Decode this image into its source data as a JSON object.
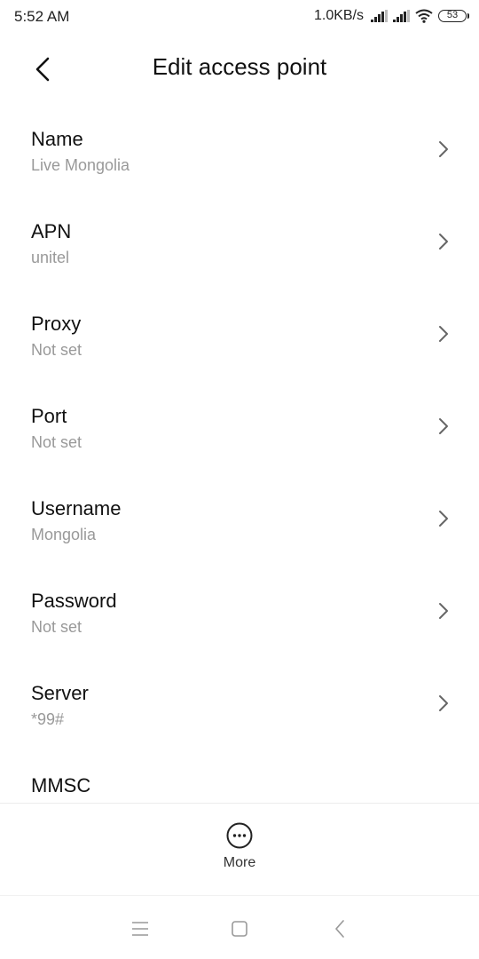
{
  "status_bar": {
    "time": "5:52 AM",
    "speed": "1.0KB/s",
    "battery": "53"
  },
  "header": {
    "title": "Edit access point"
  },
  "settings": [
    {
      "title": "Name",
      "value": "Live Mongolia"
    },
    {
      "title": "APN",
      "value": "unitel"
    },
    {
      "title": "Proxy",
      "value": "Not set"
    },
    {
      "title": "Port",
      "value": "Not set"
    },
    {
      "title": "Username",
      "value": "Mongolia"
    },
    {
      "title": "Password",
      "value": "Not set"
    },
    {
      "title": "Server",
      "value": "*99#"
    },
    {
      "title": "MMSC",
      "value": ""
    }
  ],
  "action_bar": {
    "more_label": "More"
  },
  "icons": {
    "back": "back-arrow-icon",
    "chevron": "chevron-right-icon",
    "more": "more-circle-icon",
    "nav_menu": "menu-icon",
    "nav_home": "home-square-icon",
    "nav_back": "nav-back-icon"
  }
}
